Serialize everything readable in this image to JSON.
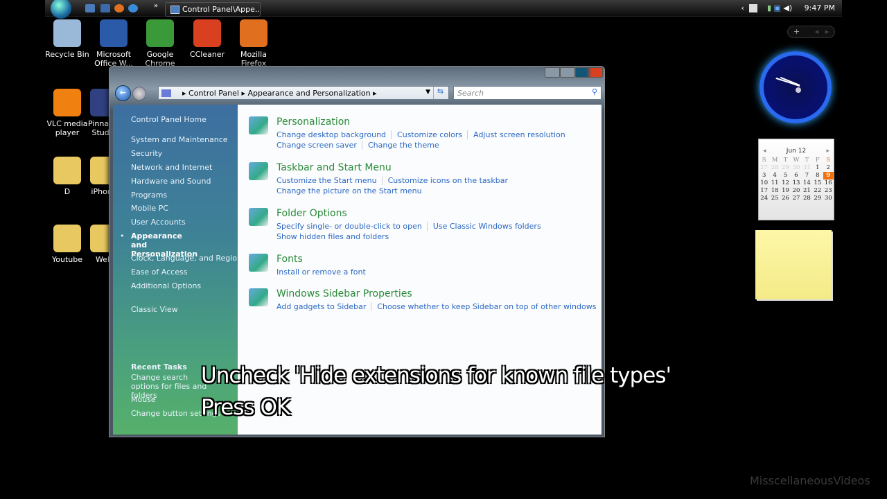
{
  "taskbar": {
    "task_button": "Control Panel\\Appe...",
    "overflow": "»",
    "clock": "9:47 PM"
  },
  "desktop_icons": [
    {
      "label": "Recycle Bin",
      "color": "#9ab8d8"
    },
    {
      "label": "Microsoft Office W...",
      "color": "#2a5aa8"
    },
    {
      "label": "Google Chrome",
      "color": "#3a9a3a"
    },
    {
      "label": "CCleaner",
      "color": "#d84020"
    },
    {
      "label": "Mozilla Firefox",
      "color": "#e07020"
    },
    {
      "label": "VLC media player",
      "color": "#f08010"
    },
    {
      "label": "Pinnacle Studio",
      "color": "#304080"
    },
    {
      "label": "D",
      "color": "#e8c860"
    },
    {
      "label": "iPhone",
      "color": "#e8c860"
    },
    {
      "label": "Youtube",
      "color": "#e8c860"
    },
    {
      "label": "Web",
      "color": "#e8c860"
    }
  ],
  "window": {
    "breadcrumb": [
      "Control Panel",
      "Appearance and Personalization"
    ],
    "search_placeholder": "Search",
    "sidebar": {
      "home": "Control Panel Home",
      "items": [
        "System and Maintenance",
        "Security",
        "Network and Internet",
        "Hardware and Sound",
        "Programs",
        "Mobile PC",
        "User Accounts",
        "Appearance and Personalization",
        "Clock, Language, and Region",
        "Ease of Access",
        "Additional Options"
      ],
      "selected": "Appearance and Personalization",
      "classic_view": "Classic View",
      "recent_title": "Recent Tasks",
      "recent": [
        "Change search options for files and folders",
        "Mouse",
        "Change button settings"
      ]
    },
    "sections": [
      {
        "title": "Personalization",
        "icon": "monitor-icon",
        "lines": [
          [
            "Change desktop background",
            "Customize colors",
            "Adjust screen resolution"
          ],
          [
            "Change screen saver",
            "Change the theme"
          ]
        ]
      },
      {
        "title": "Taskbar and Start Menu",
        "icon": "taskbar-icon",
        "lines": [
          [
            "Customize the Start menu",
            "Customize icons on the taskbar"
          ],
          [
            "Change the picture on the Start menu"
          ]
        ]
      },
      {
        "title": "Folder Options",
        "icon": "folder-options-icon",
        "lines": [
          [
            "Specify single- or double-click to open",
            "Use Classic Windows folders"
          ],
          [
            "Show hidden files and folders"
          ]
        ]
      },
      {
        "title": "Fonts",
        "icon": "fonts-icon",
        "lines": [
          [
            "Install or remove a font"
          ]
        ]
      },
      {
        "title": "Windows Sidebar Properties",
        "icon": "sidebar-icon",
        "lines": [
          [
            "Add gadgets to Sidebar",
            "Choose whether to keep Sidebar on top of other windows"
          ]
        ]
      }
    ]
  },
  "overlay": {
    "line1": "Uncheck 'Hide extensions for known file types'",
    "line2": "Press OK"
  },
  "calendar": {
    "month": "Jun 12",
    "weekdays": [
      "S",
      "M",
      "T",
      "W",
      "T",
      "F",
      "S"
    ],
    "weeks": [
      [
        "27",
        "28",
        "29",
        "30",
        "31",
        "1",
        "2"
      ],
      [
        "3",
        "4",
        "5",
        "6",
        "7",
        "8",
        "9"
      ],
      [
        "10",
        "11",
        "12",
        "13",
        "14",
        "15",
        "16"
      ],
      [
        "17",
        "18",
        "19",
        "20",
        "21",
        "22",
        "23"
      ],
      [
        "24",
        "25",
        "26",
        "27",
        "28",
        "29",
        "30"
      ]
    ],
    "today": "9",
    "accent": "#f07010"
  },
  "watermark": "MisscellaneousVideos"
}
